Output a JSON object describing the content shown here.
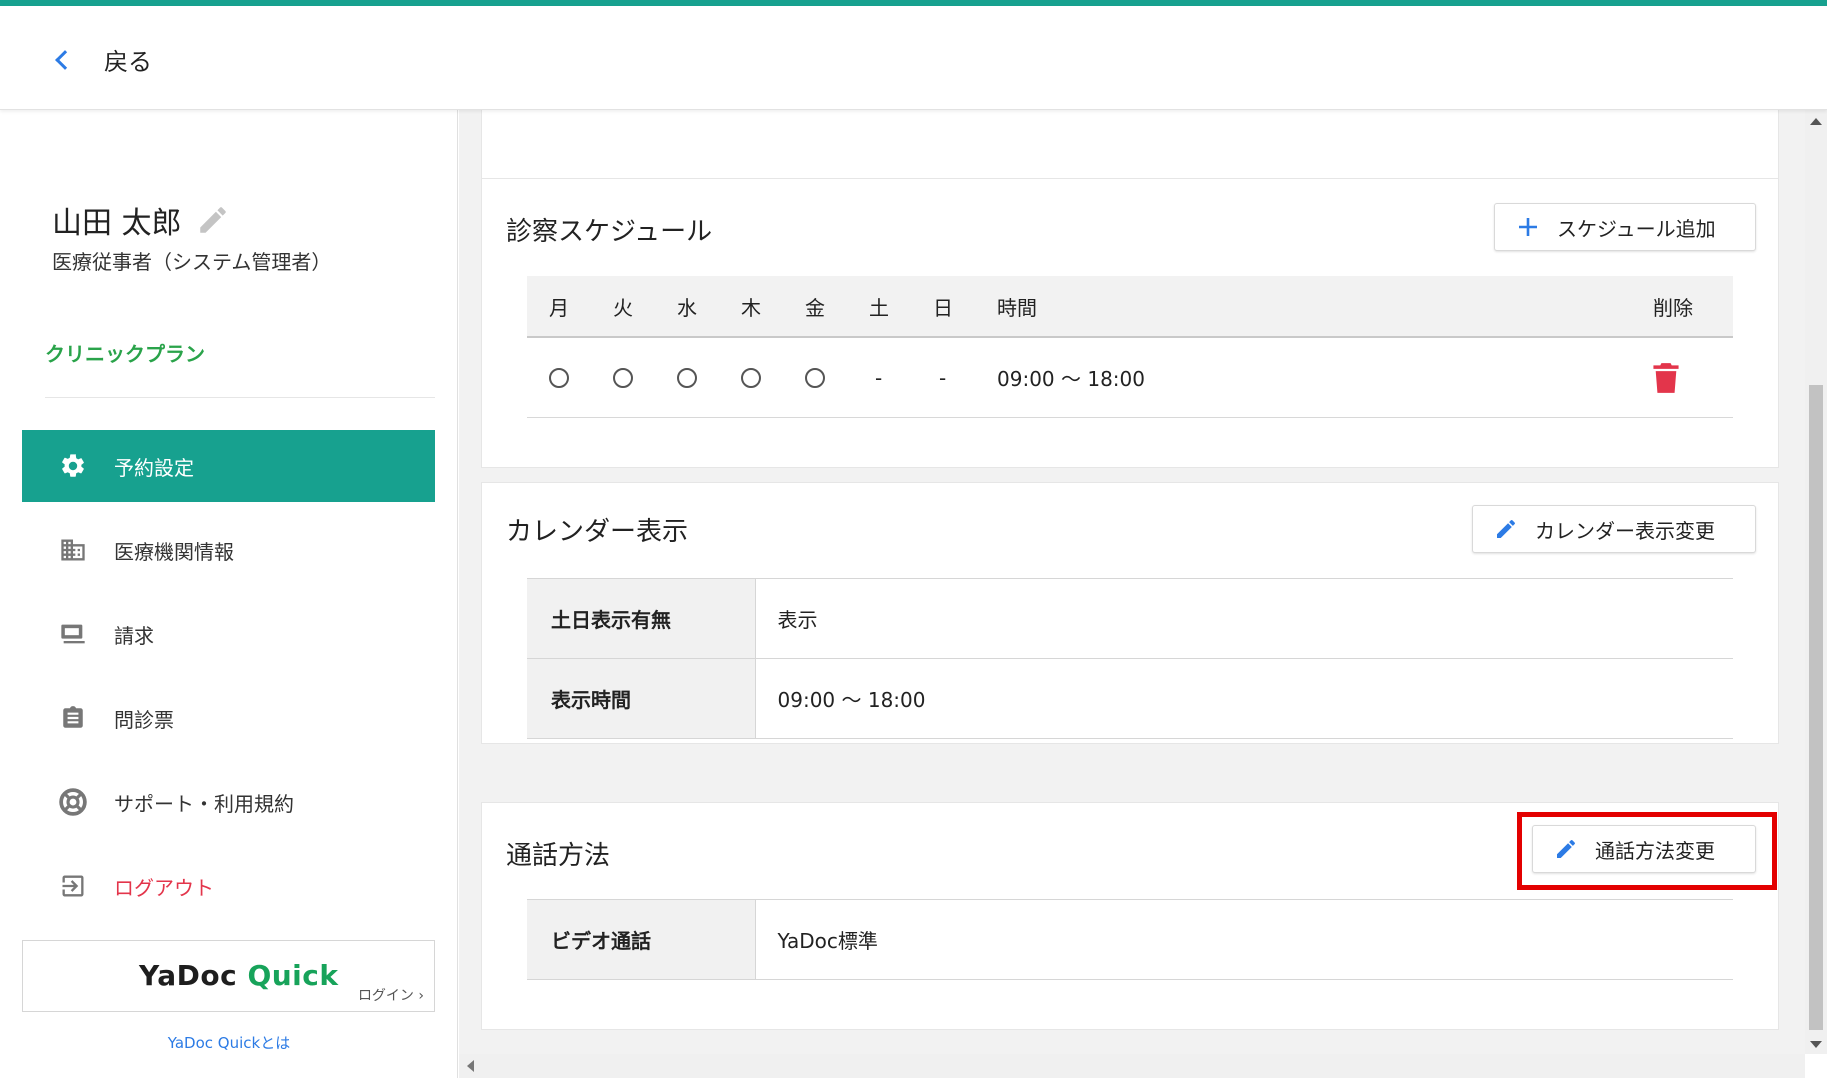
{
  "header": {
    "back_label": "戻る"
  },
  "user": {
    "name": "山田 太郎",
    "role": "医療従事者（システム管理者）"
  },
  "plan_label": "クリニックプラン",
  "nav": {
    "items": [
      {
        "label": "予約設定",
        "icon": "gear-icon",
        "active": true
      },
      {
        "label": "医療機関情報",
        "icon": "building-icon"
      },
      {
        "label": "請求",
        "icon": "billing-icon"
      },
      {
        "label": "問診票",
        "icon": "clipboard-icon"
      },
      {
        "label": "サポート・利用規約",
        "icon": "lifebuoy-icon"
      },
      {
        "label": "ログアウト",
        "icon": "logout-icon"
      }
    ]
  },
  "quick": {
    "brand_part1": "YaDoc",
    "brand_part2": "Quick",
    "login_label": "ログイン ›",
    "about_link": "YaDoc Quickとは"
  },
  "schedule": {
    "title": "診察スケジュール",
    "add_button": "スケジュール追加",
    "columns": [
      "月",
      "火",
      "水",
      "木",
      "金",
      "土",
      "日",
      "時間",
      "削除"
    ],
    "rows": [
      {
        "days": [
          "○",
          "○",
          "○",
          "○",
          "○",
          "-",
          "-"
        ],
        "time": "09:00 〜 18:00"
      }
    ]
  },
  "calendar": {
    "title": "カレンダー表示",
    "edit_button": "カレンダー表示変更",
    "rows": [
      {
        "key": "土日表示有無",
        "value": "表示"
      },
      {
        "key": "表示時間",
        "value": "09:00 〜 18:00"
      }
    ]
  },
  "call": {
    "title": "通話方法",
    "edit_button": "通話方法変更",
    "rows": [
      {
        "key": "ビデオ通話",
        "value": "YaDoc標準"
      }
    ]
  },
  "colors": {
    "accent": "#17a18f",
    "plan_green": "#2aa34a",
    "link_blue": "#2c7be5",
    "logout_red": "#e3354b",
    "highlight_red": "#e30000"
  }
}
